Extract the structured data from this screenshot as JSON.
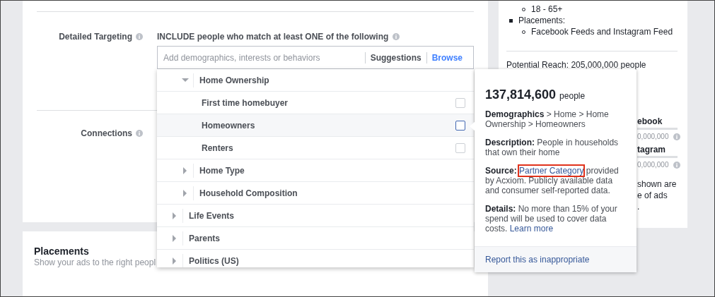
{
  "detailed_targeting": {
    "label": "Detailed Targeting",
    "instruction": "INCLUDE people who match at least ONE of the following",
    "search": {
      "placeholder": "Add demographics, interests or behaviors"
    },
    "tabs": [
      {
        "label": "Suggestions",
        "selected": false
      },
      {
        "label": "Browse",
        "selected": true
      }
    ],
    "browse_tree": [
      {
        "kind": "scrolled_parent",
        "children": [
          {
            "kind": "category",
            "label": "Home Ownership",
            "expanded": true,
            "children": [
              {
                "kind": "option",
                "label": "First time homebuyer",
                "checked": false,
                "hovered": false
              },
              {
                "kind": "option",
                "label": "Homeowners",
                "checked": false,
                "hovered": true
              },
              {
                "kind": "option",
                "label": "Renters",
                "checked": false,
                "hovered": false
              }
            ]
          },
          {
            "kind": "category",
            "label": "Home Type",
            "expanded": false
          },
          {
            "kind": "category",
            "label": "Household Composition",
            "expanded": false
          }
        ]
      },
      {
        "kind": "category",
        "label": "Life Events",
        "expanded": false
      },
      {
        "kind": "category",
        "label": "Parents",
        "expanded": false
      },
      {
        "kind": "category",
        "label": "Politics (US)",
        "expanded": false
      }
    ]
  },
  "connections": {
    "label": "Connections"
  },
  "placements": {
    "title": "Placements",
    "subtitle": "Show your ads to the right peopl"
  },
  "audience_summary": {
    "list": [
      {
        "kind": "sub",
        "text": "18 - 65+"
      },
      {
        "kind": "main",
        "text": "Placements:"
      },
      {
        "kind": "sub",
        "text": "Facebook Feeds and Instagram Feed"
      }
    ],
    "potential_reach": "Potential Reach: 205,000,000 people",
    "fragments": [
      {
        "kind": "heading",
        "text": "ebook"
      },
      {
        "kind": "estimate",
        "text": "0,000,000"
      },
      {
        "kind": "heading",
        "text": "tagram"
      },
      {
        "kind": "estimate",
        "text": "0,000,000"
      },
      {
        "kind": "note",
        "text": "shown are"
      },
      {
        "kind": "note",
        "text": "e of ads"
      },
      {
        "kind": "note",
        "text": "."
      }
    ]
  },
  "info_popup": {
    "count": "137,814,600",
    "count_unit": "people",
    "paragraphs": [
      {
        "lead": "**Demographics** > Home > Home Ownership > Homeowners"
      },
      {
        "lead": "**Description:** People in households that own their home"
      },
      {
        "lead": "**Source:**",
        "link": "Partner Category",
        "link_outlined": true,
        "tail": "provided by Acxiom. Publicly available data and consumer self-reported data."
      },
      {
        "lead": "**Details:** No more than 15% of your spend will be used to cover data costs.",
        "link": "Learn more",
        "link_outlined": false
      }
    ],
    "footer_link": "Report this as inappropriate"
  }
}
